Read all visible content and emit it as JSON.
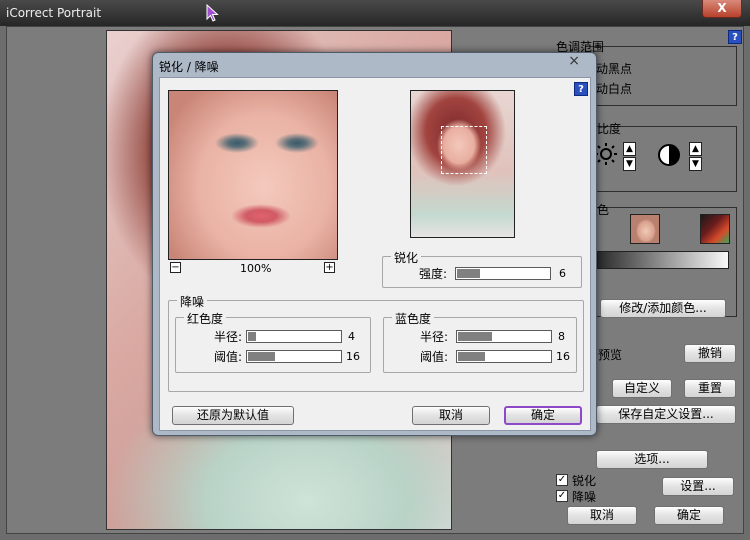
{
  "app": {
    "title": "iCorrect Portrait",
    "close_glyph": "X"
  },
  "right_panel": {
    "help_glyph": "?",
    "color_range": {
      "title": "色调范围",
      "black_point": "动黑点",
      "white_point": "动白点"
    },
    "contrast": {
      "title": "比度"
    },
    "color": {
      "title": "色"
    },
    "edit_color_button": "修改/添加颜色...",
    "preview_label": "预览",
    "undo_button": "撤销",
    "custom_button": "自定义",
    "reset_button": "重置",
    "save_custom_button": "保存自定义设置...",
    "options_button": "选项...",
    "sharpen_checkbox": "锐化",
    "denoise_checkbox": "降噪",
    "settings_button": "设置...",
    "cancel_button": "取消",
    "ok_button": "确定",
    "check_glyph": "✓"
  },
  "dialog": {
    "title": "锐化 / 降噪",
    "close_glyph": "×",
    "help_glyph": "?",
    "zoom_out": "−",
    "zoom_in": "+",
    "zoom_level": "100%",
    "sharpen": {
      "title": "锐化",
      "strength_label": "强度:",
      "strength": 6,
      "strength_max": 100
    },
    "denoise": {
      "title": "降噪",
      "red": {
        "title": "红色度",
        "radius_label": "半径:",
        "radius": 4,
        "threshold_label": "阈值:",
        "threshold": 16
      },
      "blue": {
        "title": "蓝色度",
        "radius_label": "半径:",
        "radius": 8,
        "threshold_label": "阈值:",
        "threshold": 16
      }
    },
    "reset_default_button": "还原为默认值",
    "cancel_button": "取消",
    "ok_button": "确定"
  }
}
